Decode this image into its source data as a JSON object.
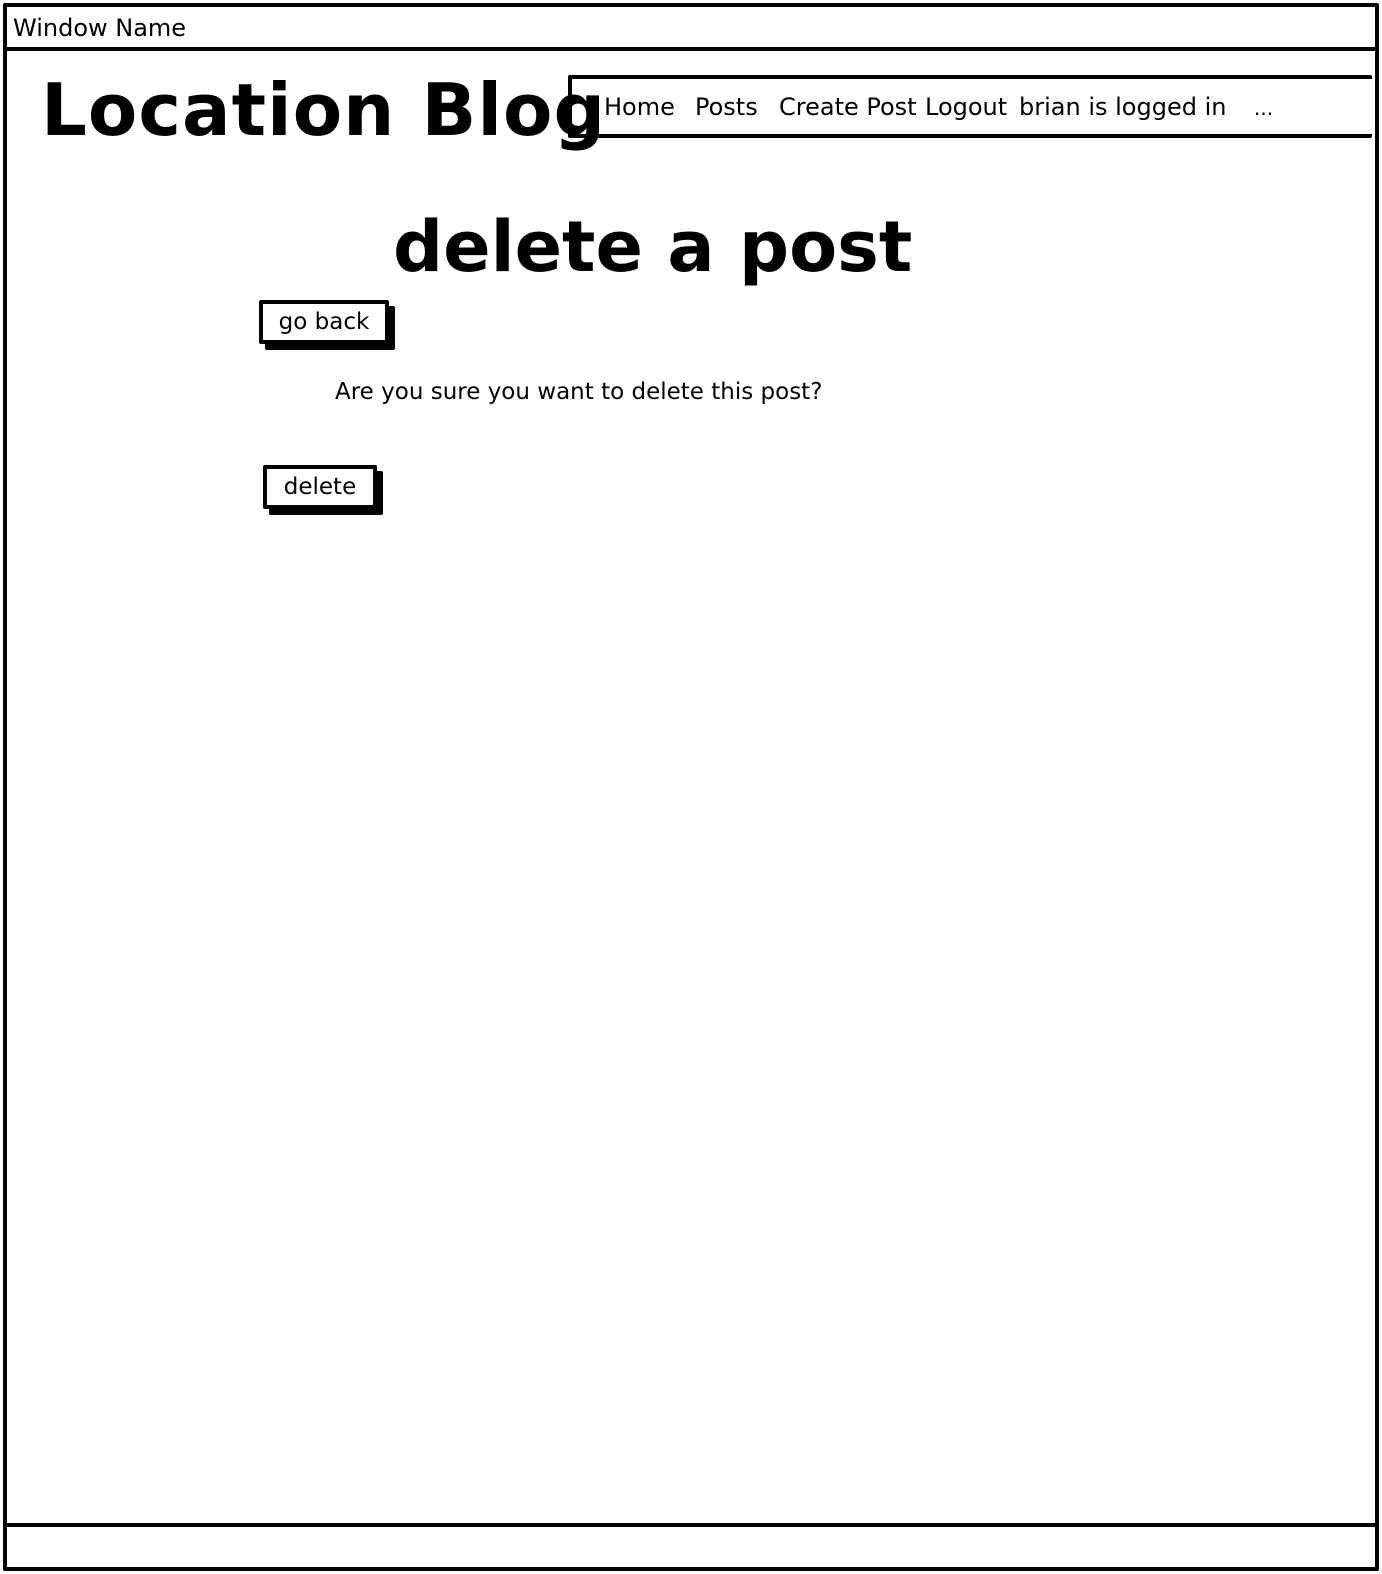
{
  "window": {
    "title": "Window Name"
  },
  "header": {
    "logo": "Location Blog",
    "nav": {
      "home": "Home",
      "posts": "Posts",
      "create_post": "Create Post",
      "logout": "Logout",
      "status": "brian is logged in",
      "more": "..."
    }
  },
  "main": {
    "title": "delete a post",
    "back_label": "go back",
    "confirm_text": "Are you sure you want to delete this post?",
    "delete_label": "delete"
  }
}
